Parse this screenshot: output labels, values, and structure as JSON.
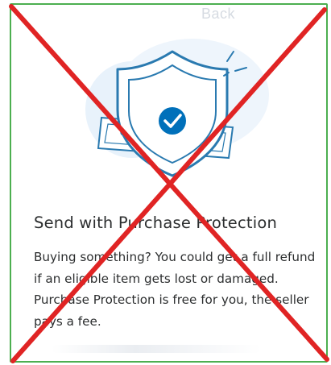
{
  "header": {
    "faded_text": "Back"
  },
  "content": {
    "heading": "Send with Purchase Protection",
    "body": "Buying something? You could get a full refund if an eligible item gets lost or damaged. Purchase Protection is free for you, the seller pays a fee."
  },
  "illustration": {
    "icon": "shield-checkmark-icon",
    "accent_color": "#0070ba",
    "line_color": "#2a7ab0",
    "background_blob_color": "#e8f2fb"
  },
  "overlay": {
    "icon": "red-x-cross-icon",
    "color": "#e02424"
  },
  "frame": {
    "border_color": "#4caf50"
  }
}
